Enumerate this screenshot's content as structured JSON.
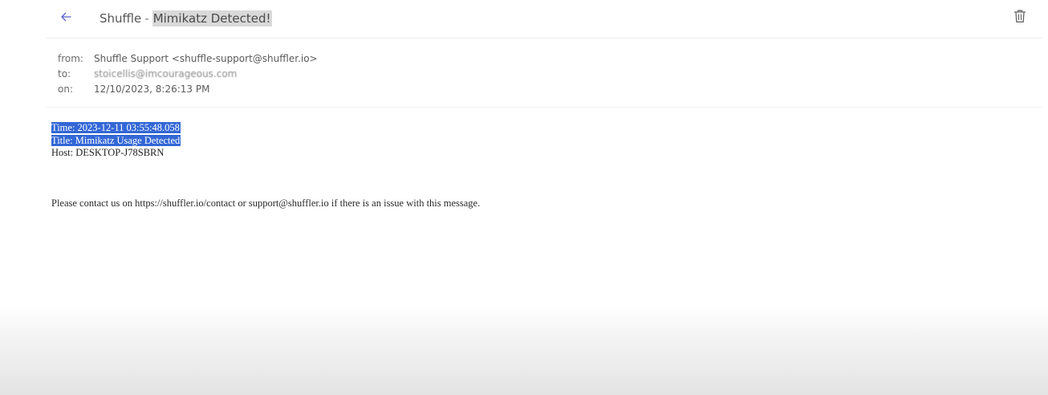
{
  "header": {
    "back_icon": "arrow-left-icon",
    "sender_name": "Shuffle",
    "separator": "-",
    "subject_highlight": "Mimikatz Detected!",
    "delete_icon": "trash-icon",
    "accent_color": "#5b5fc7"
  },
  "meta": {
    "from_label": "from:",
    "from_value": "Shuffle Support <shuffle-support@shuffler.io>",
    "to_label": "to:",
    "to_value": "stoicellis@imcourageous.com",
    "on_label": "on:",
    "on_value": "12/10/2023, 8:26:13 PM"
  },
  "body": {
    "time_line": "Time: 2023-12-11 03:55:48.058",
    "title_line": "Title: Mimikatz Usage Detected",
    "host_line": "Host: DESKTOP-J78SBRN",
    "footer": "Please contact us on https://shuffler.io/contact or support@shuffler.io if there is an issue with this message.",
    "selection_color": "#3367d6"
  }
}
